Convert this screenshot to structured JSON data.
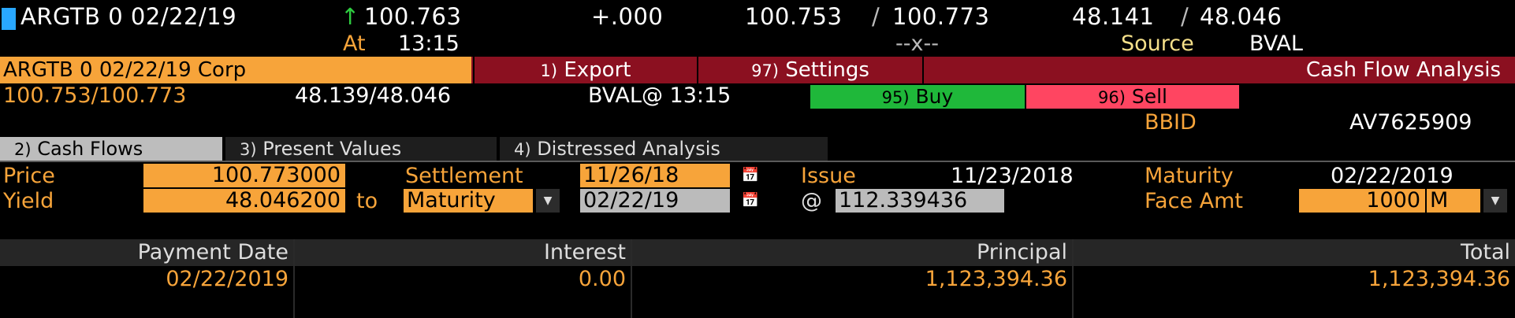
{
  "colors": {
    "accent": "#f7a43a",
    "buy": "#1fb83a",
    "sell": "#ff4561",
    "title_bar": "#8b1020"
  },
  "top": {
    "ticker": "ARGTB 0 02/22/19",
    "arrow": "↑",
    "last_price": "100.763",
    "change": "+.000",
    "bid_ask": "100.753",
    "bid_ask_sep": "/",
    "ask": "100.773",
    "yield_bid": "48.141",
    "yield_sep": "/",
    "yield_ask": "48.046",
    "at_label": "At",
    "time": "13:15",
    "dashes": "--x--",
    "source_label": "Source",
    "source_value": "BVAL"
  },
  "titlebar": {
    "security": "ARGTB 0 02/22/19 Corp",
    "export_num": "1)",
    "export_label": "Export",
    "settings_num": "97)",
    "settings_label": "Settings",
    "function_title": "Cash Flow Analysis"
  },
  "quote": {
    "price_pair": "100.753/100.773",
    "yield_pair": "48.139/48.046",
    "source_time": "BVAL@ 13:15",
    "buy_num": "95)",
    "buy_label": "Buy",
    "sell_num": "96)",
    "sell_label": "Sell",
    "bbid_label": "BBID",
    "bbid_value": "AV7625909"
  },
  "tabs": [
    {
      "num": "2)",
      "label": "Cash Flows"
    },
    {
      "num": "3)",
      "label": "Present Values"
    },
    {
      "num": "4)",
      "label": "Distressed Analysis"
    }
  ],
  "form": {
    "price_label": "Price",
    "price_value": "100.773000",
    "yield_label": "Yield",
    "yield_value": "48.046200",
    "to_label": "to",
    "to_select": "Maturity",
    "settlement_label": "Settlement",
    "settlement_value": "11/26/18",
    "workout_date": "02/22/19",
    "issue_label": "Issue",
    "issue_value": "11/23/2018",
    "at_symbol": "@",
    "workout_price": "112.339436",
    "maturity_label": "Maturity",
    "maturity_value": "02/22/2019",
    "face_label": "Face Amt",
    "face_value": "1000",
    "face_unit": "M"
  },
  "table": {
    "headers": [
      "Payment Date",
      "Interest",
      "Principal",
      "Total"
    ],
    "rows": [
      [
        "02/22/2019",
        "0.00",
        "1,123,394.36",
        "1,123,394.36"
      ]
    ]
  }
}
